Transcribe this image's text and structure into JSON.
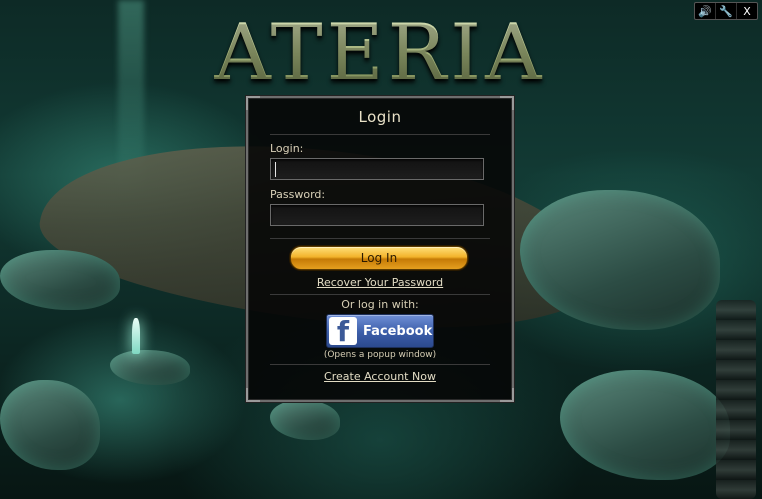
{
  "logo_text": "ATERIA",
  "window_controls": {
    "sound_label": "🔊",
    "settings_label": "🔧",
    "close_label": "X"
  },
  "login_panel": {
    "title": "Login",
    "login_label": "Login:",
    "login_value": "",
    "password_label": "Password:",
    "password_value": "",
    "login_button": "Log In",
    "recover_link": "Recover Your Password",
    "alt_login_text": "Or log in with:",
    "facebook_button": "Facebook",
    "facebook_note": "(Opens a popup window)",
    "create_account_link": "Create Account Now"
  },
  "colors": {
    "accent_gold": "#f3b32b",
    "facebook_blue": "#3b5da8",
    "panel_bg": "#060606",
    "text_cream": "#e9e2c8"
  }
}
